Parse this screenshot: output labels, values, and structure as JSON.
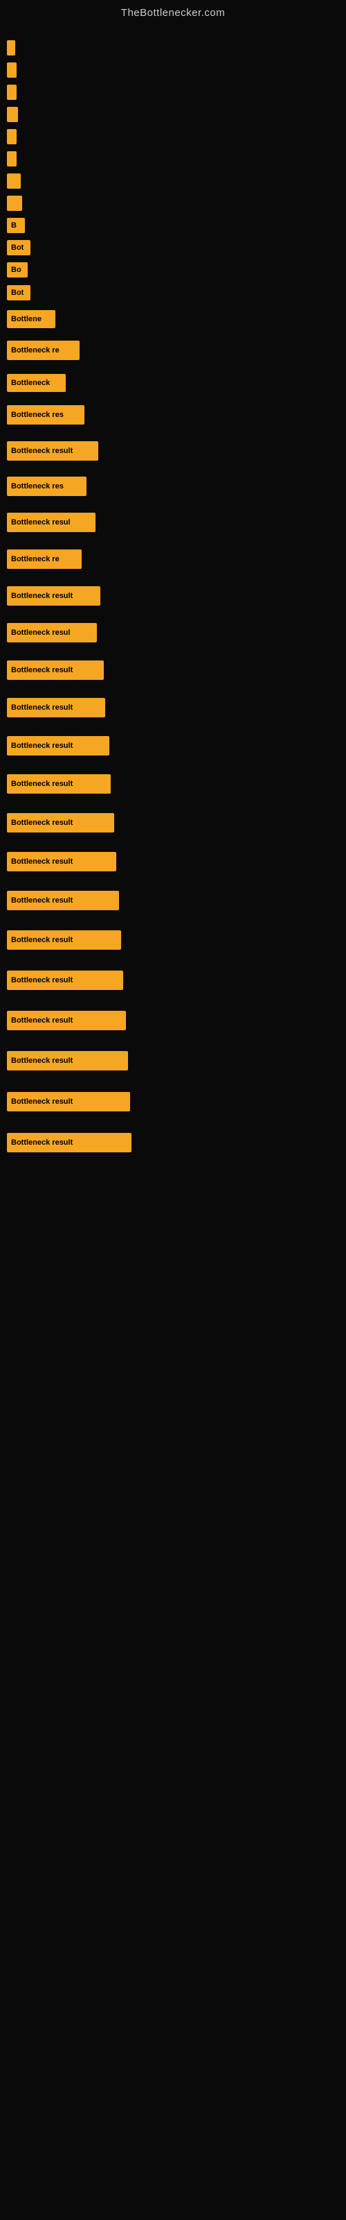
{
  "site": {
    "title": "TheBottlenecker.com"
  },
  "bars": [
    {
      "id": 1,
      "label": "",
      "width": 12,
      "visible_text": ""
    },
    {
      "id": 2,
      "label": "",
      "width": 14,
      "visible_text": ""
    },
    {
      "id": 3,
      "label": "",
      "width": 14,
      "visible_text": ""
    },
    {
      "id": 4,
      "label": "",
      "width": 16,
      "visible_text": ""
    },
    {
      "id": 5,
      "label": "",
      "width": 14,
      "visible_text": ""
    },
    {
      "id": 6,
      "label": "",
      "width": 14,
      "visible_text": ""
    },
    {
      "id": 7,
      "label": "",
      "width": 20,
      "visible_text": ""
    },
    {
      "id": 8,
      "label": "",
      "width": 22,
      "visible_text": ""
    },
    {
      "id": 9,
      "label": "B",
      "width": 26,
      "visible_text": "B"
    },
    {
      "id": 10,
      "label": "Bot",
      "width": 34,
      "visible_text": "Bot"
    },
    {
      "id": 11,
      "label": "Bo",
      "width": 30,
      "visible_text": "Bo"
    },
    {
      "id": 12,
      "label": "Bot",
      "width": 34,
      "visible_text": "Bot"
    },
    {
      "id": 13,
      "label": "Bottlene",
      "width": 70,
      "visible_text": "Bottlene"
    },
    {
      "id": 14,
      "label": "Bottleneck re",
      "width": 105,
      "visible_text": "Bottleneck re"
    },
    {
      "id": 15,
      "label": "Bottleneck",
      "width": 85,
      "visible_text": "Bottleneck"
    },
    {
      "id": 16,
      "label": "Bottleneck res",
      "width": 112,
      "visible_text": "Bottleneck res"
    },
    {
      "id": 17,
      "label": "Bottleneck result",
      "width": 132,
      "visible_text": "Bottleneck result"
    },
    {
      "id": 18,
      "label": "Bottleneck res",
      "width": 115,
      "visible_text": "Bottleneck res"
    },
    {
      "id": 19,
      "label": "Bottleneck resul",
      "width": 128,
      "visible_text": "Bottleneck resul"
    },
    {
      "id": 20,
      "label": "Bottleneck re",
      "width": 108,
      "visible_text": "Bottleneck re"
    },
    {
      "id": 21,
      "label": "Bottleneck result",
      "width": 135,
      "visible_text": "Bottleneck result"
    },
    {
      "id": 22,
      "label": "Bottleneck resul",
      "width": 130,
      "visible_text": "Bottleneck resul"
    },
    {
      "id": 23,
      "label": "Bottleneck result",
      "width": 140,
      "visible_text": "Bottleneck result"
    },
    {
      "id": 24,
      "label": "Bottleneck result",
      "width": 142,
      "visible_text": "Bottleneck result"
    },
    {
      "id": 25,
      "label": "Bottleneck result",
      "width": 148,
      "visible_text": "Bottleneck result"
    },
    {
      "id": 26,
      "label": "Bottleneck result",
      "width": 150,
      "visible_text": "Bottleneck result"
    },
    {
      "id": 27,
      "label": "Bottleneck result",
      "width": 155,
      "visible_text": "Bottleneck result"
    },
    {
      "id": 28,
      "label": "Bottleneck result",
      "width": 158,
      "visible_text": "Bottleneck result"
    },
    {
      "id": 29,
      "label": "Bottleneck result",
      "width": 162,
      "visible_text": "Bottleneck result"
    },
    {
      "id": 30,
      "label": "Bottleneck result",
      "width": 165,
      "visible_text": "Bottleneck result"
    },
    {
      "id": 31,
      "label": "Bottleneck result",
      "width": 168,
      "visible_text": "Bottleneck result"
    },
    {
      "id": 32,
      "label": "Bottleneck result",
      "width": 172,
      "visible_text": "Bottleneck result"
    },
    {
      "id": 33,
      "label": "Bottleneck result",
      "width": 175,
      "visible_text": "Bottleneck result"
    },
    {
      "id": 34,
      "label": "Bottleneck result",
      "width": 178,
      "visible_text": "Bottleneck result"
    },
    {
      "id": 35,
      "label": "Bottleneck result",
      "width": 180,
      "visible_text": "Bottleneck result"
    }
  ],
  "colors": {
    "bar_fill": "#f5a623",
    "bar_text": "#000000",
    "background": "#0a0a0a",
    "title": "#cccccc"
  }
}
